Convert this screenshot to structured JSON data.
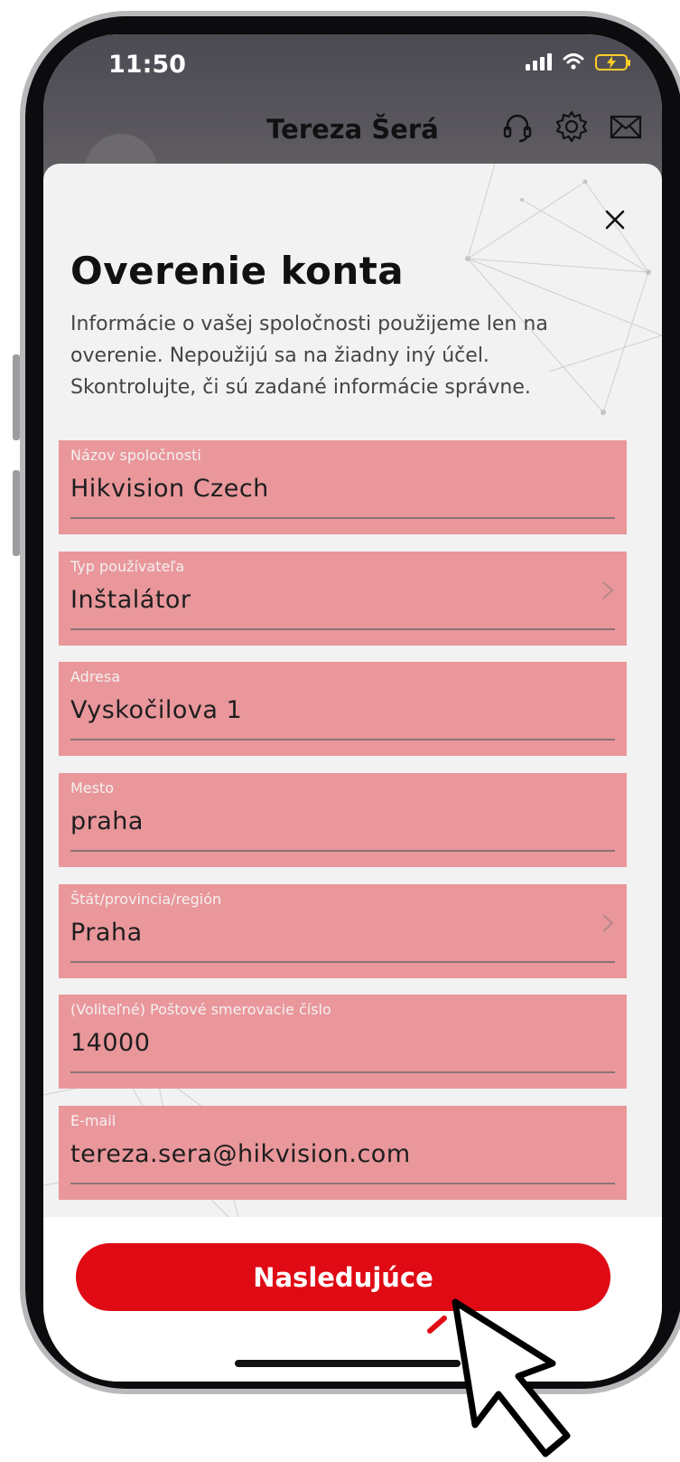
{
  "status_bar": {
    "time": "11:50",
    "signal_icon": "signal-bars-icon",
    "wifi_icon": "wifi-icon",
    "battery_icon": "battery-charging-icon",
    "battery_color": "#ffce28"
  },
  "header": {
    "user_name": "Tereza Šerá",
    "icons": [
      "headset-icon",
      "gear-icon",
      "mail-icon"
    ]
  },
  "modal": {
    "close_icon": "close-icon",
    "title": "Overenie konta",
    "description": "Informácie o vašej spoločnosti použijeme len na overenie. Nepoužijú sa na žiadny iný účel. Skontrolujte, či sú zadané informácie správne.",
    "fields": [
      {
        "label": "Názov spoločnosti",
        "value": "Hikvision Czech",
        "has_chevron": false
      },
      {
        "label": "Typ používateľa",
        "value": "Inštalátor",
        "has_chevron": true
      },
      {
        "label": "Adresa",
        "value": "Vyskočilova 1",
        "has_chevron": false
      },
      {
        "label": "Mesto",
        "value": "praha",
        "has_chevron": false
      },
      {
        "label": "Štát/provincia/región",
        "value": "Praha",
        "has_chevron": true
      },
      {
        "label": "(Voliteľné) Poštové smerovacie číslo",
        "value": "14000",
        "has_chevron": false
      },
      {
        "label": "E-mail",
        "value": "tereza.sera@hikvision.com",
        "has_chevron": false
      }
    ],
    "next_button": "Nasledujúce"
  },
  "colors": {
    "accent": "#e00a14",
    "field_highlight": "#e9979b",
    "sheet_background": "#f2f2f2"
  },
  "overlay": {
    "pointer_icon": "hand-pointer-icon",
    "click_burst_icon": "click-burst-icon"
  }
}
